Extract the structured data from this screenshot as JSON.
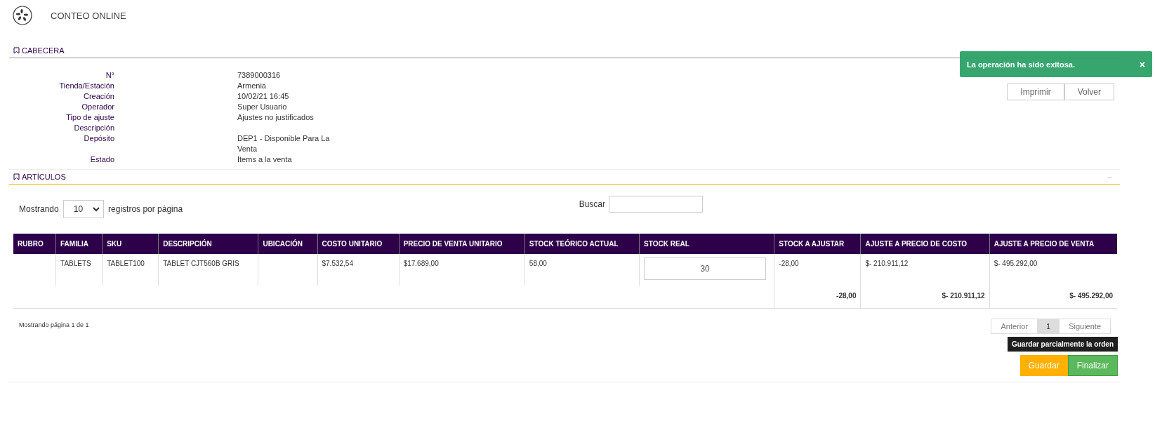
{
  "app": {
    "title": "CONTEO ONLINE"
  },
  "header_section": {
    "title": "CABECERA",
    "fields": [
      {
        "label": "N°",
        "value": "7389000316"
      },
      {
        "label": "Tienda/Estación",
        "value": "Armenia"
      },
      {
        "label": "Creación",
        "value": "10/02/21 16:45"
      },
      {
        "label": "Operador",
        "value": "Super Usuario"
      },
      {
        "label": "Tipo de ajuste",
        "value": "Ajustes no justificados"
      },
      {
        "label": "Descripción"
      },
      {
        "label": "Depósito",
        "value": "DEP1 - Disponible Para La Venta"
      },
      {
        "label": "Estado",
        "value": "Items a la venta"
      }
    ],
    "buttons": [
      "Imprimir",
      "Volver"
    ]
  },
  "toast": {
    "message": "La operación ha sido exitosa.",
    "close": "×"
  },
  "articles_section": {
    "title": "ARTÍCULOS",
    "collapse": "–",
    "page_size": {
      "before": "Mostrando",
      "value": "10",
      "after": "registros por página"
    },
    "search": {
      "label": "Buscar"
    },
    "table": {
      "columns": [
        "RUBRO",
        "FAMILIA",
        "SKU",
        "DESCRIPCIÓN",
        "UBICACIÓN",
        "COSTO UNITARIO",
        "PRECIO DE VENTA UNITARIO",
        "STOCK TEÓRICO ACTUAL",
        "STOCK REAL",
        "STOCK A AJUSTAR",
        "AJUSTE A PRECIO DE COSTO",
        "AJUSTE A PRECIO DE VENTA"
      ],
      "rows": [
        {
          "cells": [
            "",
            "TABLETS",
            "TABLET100",
            "TABLET CJT560B GRIS",
            "",
            "$7.532,54",
            "$17.689,00",
            "58,00",
            "30",
            "-28,00",
            "$- 210.911,12",
            "$- 495.292,00"
          ]
        }
      ],
      "totals": [
        "-28,00",
        "$- 210.911,12",
        "$- 495.292,00"
      ]
    },
    "info": "Mostrando página 1 de 1",
    "pagination": [
      {
        "label": "Anterior",
        "selected": false
      },
      {
        "label": "1",
        "selected": true
      },
      {
        "label": "Siguiente",
        "selected": false
      }
    ],
    "tooltip": "Guardar parcialmente la orden",
    "actions": [
      {
        "label": "Guardar",
        "kind": "warning"
      },
      {
        "label": "Finalizar",
        "kind": "success"
      }
    ]
  }
}
